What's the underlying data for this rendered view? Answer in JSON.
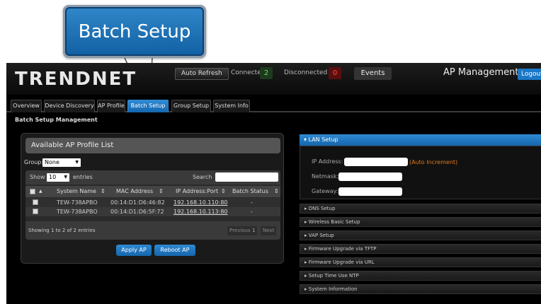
{
  "callout": {
    "label": "Batch Setup"
  },
  "header": {
    "logo": "TRENDNET",
    "auto_refresh": "Auto Refresh",
    "connected_label": "Connected",
    "connected_count": "2",
    "disconnected_label": "Disconnected",
    "disconnected_count": "0",
    "events": "Events",
    "title": "AP Management",
    "logout": "Logout"
  },
  "tabs": [
    {
      "label": "Overview"
    },
    {
      "label": "Device Discovery"
    },
    {
      "label": "AP Profile"
    },
    {
      "label": "Batch Setup",
      "active": true
    },
    {
      "label": "Group Setup"
    },
    {
      "label": "System Info"
    }
  ],
  "page": {
    "subtitle": "Batch Setup Management"
  },
  "profile_list": {
    "title": "Available AP Profile List",
    "group_label": "Group:",
    "group_value": "None",
    "show_label": "Show",
    "entries_value": "10",
    "entries_label": "entries",
    "search_label": "Search",
    "columns": [
      "System Name",
      "MAC Address",
      "IP Address:Port",
      "Batch Status"
    ],
    "rows": [
      {
        "name": "TEW-738APBO",
        "mac": "00:14:D1:D6:46:82",
        "ip": "192.168.10.110:80",
        "status": "-"
      },
      {
        "name": "TEW-738APBO",
        "mac": "00:14:D1:D6:5F:72",
        "ip": "192.168.10.113:80",
        "status": "-"
      }
    ],
    "showing": "Showing 1 to 2 of 2 entries",
    "pager": {
      "previous": "Previous",
      "page": "1",
      "next": "Next"
    },
    "apply_button": "Apply AP",
    "reboot_button": "Reboot AP"
  },
  "accordion": {
    "lan": {
      "title": "LAN Setup",
      "ip_label": "IP Address:",
      "auto_increment": "(Auto Increment)",
      "netmask_label": "Netmask:",
      "gateway_label": "Gateway:"
    },
    "items": [
      "DNS Setup",
      "Wireless Basic Setup",
      "VAP Setup",
      "Firmware Upgrade via TFTP",
      "Firmware Upgrade via URL",
      "Setup Time Use NTP",
      "System Information"
    ]
  },
  "colors": {
    "accent": "#1b78c7",
    "connected": "#6fd66f",
    "disconnected": "#ff4b4b",
    "auto_increment": "#e07b1e"
  }
}
